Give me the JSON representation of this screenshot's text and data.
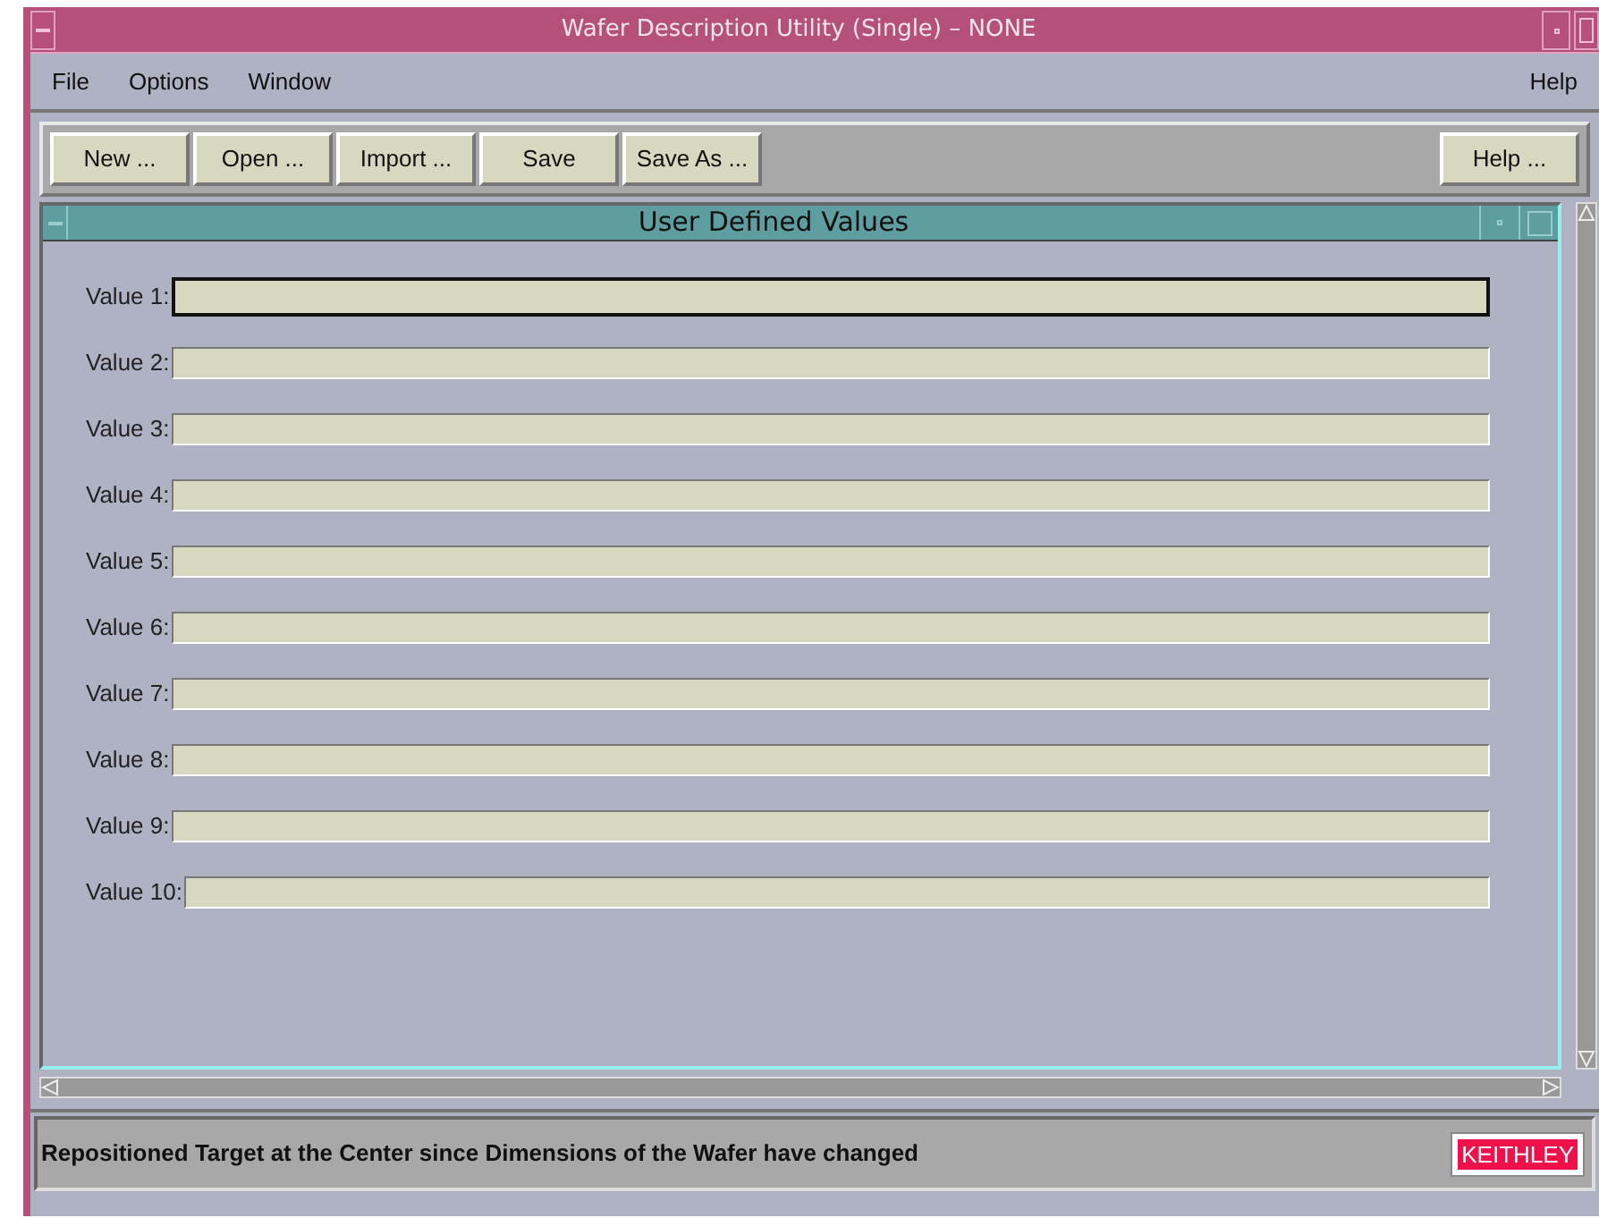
{
  "window": {
    "title": "Wafer Description Utility (Single) – NONE"
  },
  "menu": {
    "left": [
      "File",
      "Options",
      "Window"
    ],
    "right": [
      "Help"
    ]
  },
  "toolbar": {
    "left": [
      "New ...",
      "Open ...",
      "Import ...",
      "Save",
      "Save As ..."
    ],
    "right": [
      "Help ..."
    ]
  },
  "panel": {
    "title": "User Defined Values",
    "fields": [
      {
        "label": "Value 1:",
        "focused": true
      },
      {
        "label": "Value 2:",
        "focused": false
      },
      {
        "label": "Value 3:",
        "focused": false
      },
      {
        "label": "Value 4:",
        "focused": false
      },
      {
        "label": "Value 5:",
        "focused": false
      },
      {
        "label": "Value 6:",
        "focused": false
      },
      {
        "label": "Value 7:",
        "focused": false
      },
      {
        "label": "Value 8:",
        "focused": false
      },
      {
        "label": "Value 9:",
        "focused": false
      },
      {
        "label": "Value 10:",
        "focused": false
      }
    ]
  },
  "status_bar": {
    "message": "Repositioned Target at the Center since Dimensions of the Wafer have changed",
    "logo": "KEITHLEY"
  }
}
